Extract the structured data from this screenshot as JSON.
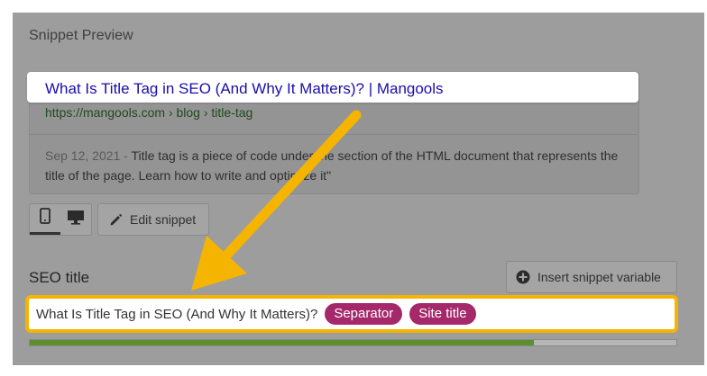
{
  "panel": {
    "heading": "Snippet Preview"
  },
  "snippet": {
    "title": "What Is Title Tag in SEO (And Why It Matters)? | Mangools",
    "url": "https://mangools.com › blog › title-tag",
    "date": "Sep 12, 2021 - ",
    "description": "Title tag is a piece of code under the section of the HTML document that represents the title of the page. Learn how to write and optimize it\""
  },
  "toolbar": {
    "mobile_icon": "mobile-icon",
    "desktop_icon": "desktop-icon",
    "edit_label": "Edit snippet",
    "edit_icon": "pencil-icon",
    "selected_device": "mobile"
  },
  "seo_title": {
    "label": "SEO title",
    "insert_label": "Insert snippet variable",
    "insert_icon": "plus-circle-icon",
    "input_text": "What Is Title Tag in SEO (And Why It Matters)?",
    "variables": [
      "Separator",
      "Site title"
    ],
    "progress_fraction": 0.78
  },
  "colors": {
    "highlight_border": "#f5b400",
    "arrow": "#f5b400",
    "link": "#1a0dab",
    "pill": "#a4286a",
    "progress": "#5c8f2d"
  }
}
